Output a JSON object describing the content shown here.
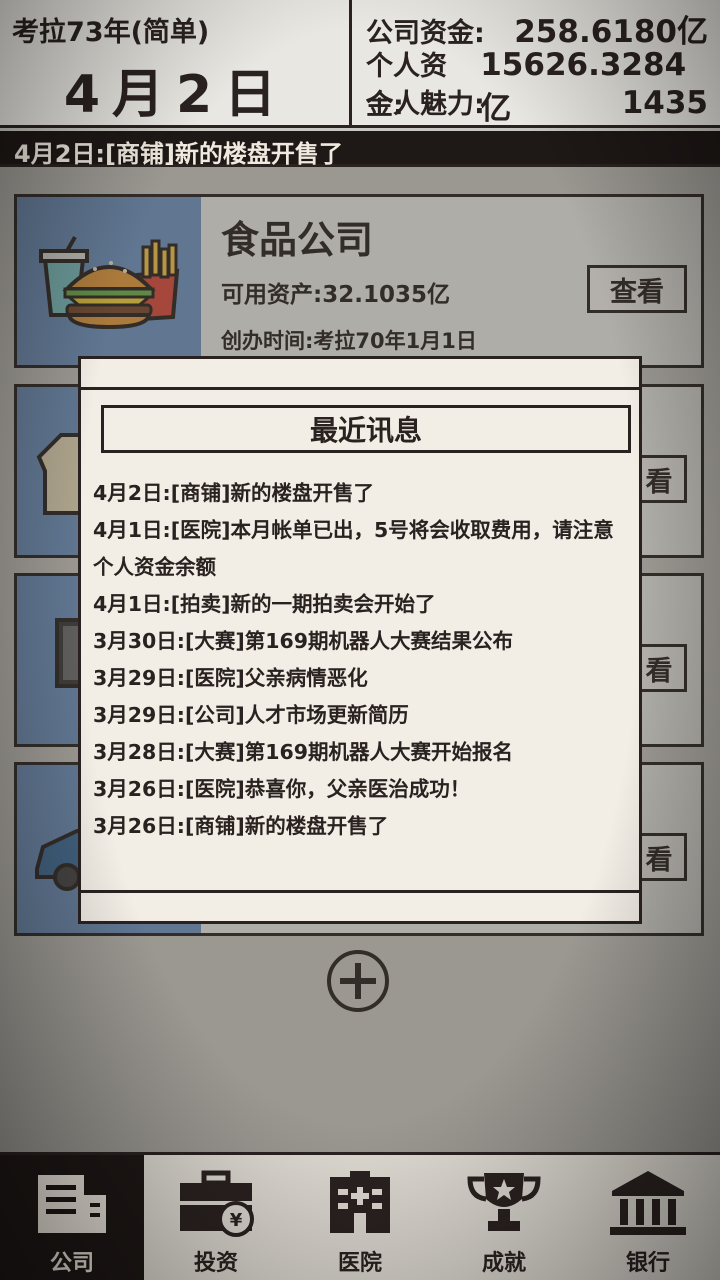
{
  "header": {
    "year_difficulty": "考拉73年(简单)",
    "date": "4月2日",
    "stats": [
      {
        "label": "公司资金:",
        "value": "258.6180亿"
      },
      {
        "label": "个人资金:",
        "value": "15626.3284亿"
      },
      {
        "label": "个人魅力:",
        "value": "1435"
      }
    ]
  },
  "ticker": {
    "text": "4月2日:[商铺]新的楼盘开售了"
  },
  "companies": [
    {
      "name": "食品公司",
      "assets": "可用资产:32.1035亿",
      "founded": "创办时间:考拉70年1月1日",
      "button": "查看",
      "icon": "burger-fries-icon"
    },
    {
      "button": "看",
      "icon": "shirt-icon"
    },
    {
      "button": "看",
      "icon": "monitor-icon"
    },
    {
      "button": "看",
      "icon": "car-icon"
    }
  ],
  "modal": {
    "title": "最近讯息",
    "messages": [
      "4月2日:[商铺]新的楼盘开售了",
      "4月1日:[医院]本月帐单已出，5号将会收取费用，请注意个人资金余额",
      "4月1日:[拍卖]新的一期拍卖会开始了",
      "3月30日:[大赛]第169期机器人大赛结果公布",
      "3月29日:[医院]父亲病情恶化",
      "3月29日:[公司]人才市场更新简历",
      "3月28日:[大赛]第169期机器人大赛开始报名",
      "3月26日:[医院]恭喜你，父亲医治成功！",
      "3月26日:[商铺]新的楼盘开售了"
    ]
  },
  "nav": [
    {
      "label": "公司",
      "icon": "company-building-icon",
      "active": true
    },
    {
      "label": "投资",
      "icon": "briefcase-yen-icon",
      "active": false
    },
    {
      "label": "医院",
      "icon": "hospital-icon",
      "active": false
    },
    {
      "label": "成就",
      "icon": "trophy-icon",
      "active": false
    },
    {
      "label": "银行",
      "icon": "bank-icon",
      "active": false
    }
  ],
  "colors": {
    "background": "#c9c7c1",
    "panel": "#e9e7e1",
    "dark": "#1e1816",
    "card_image": "#6f93bf"
  }
}
